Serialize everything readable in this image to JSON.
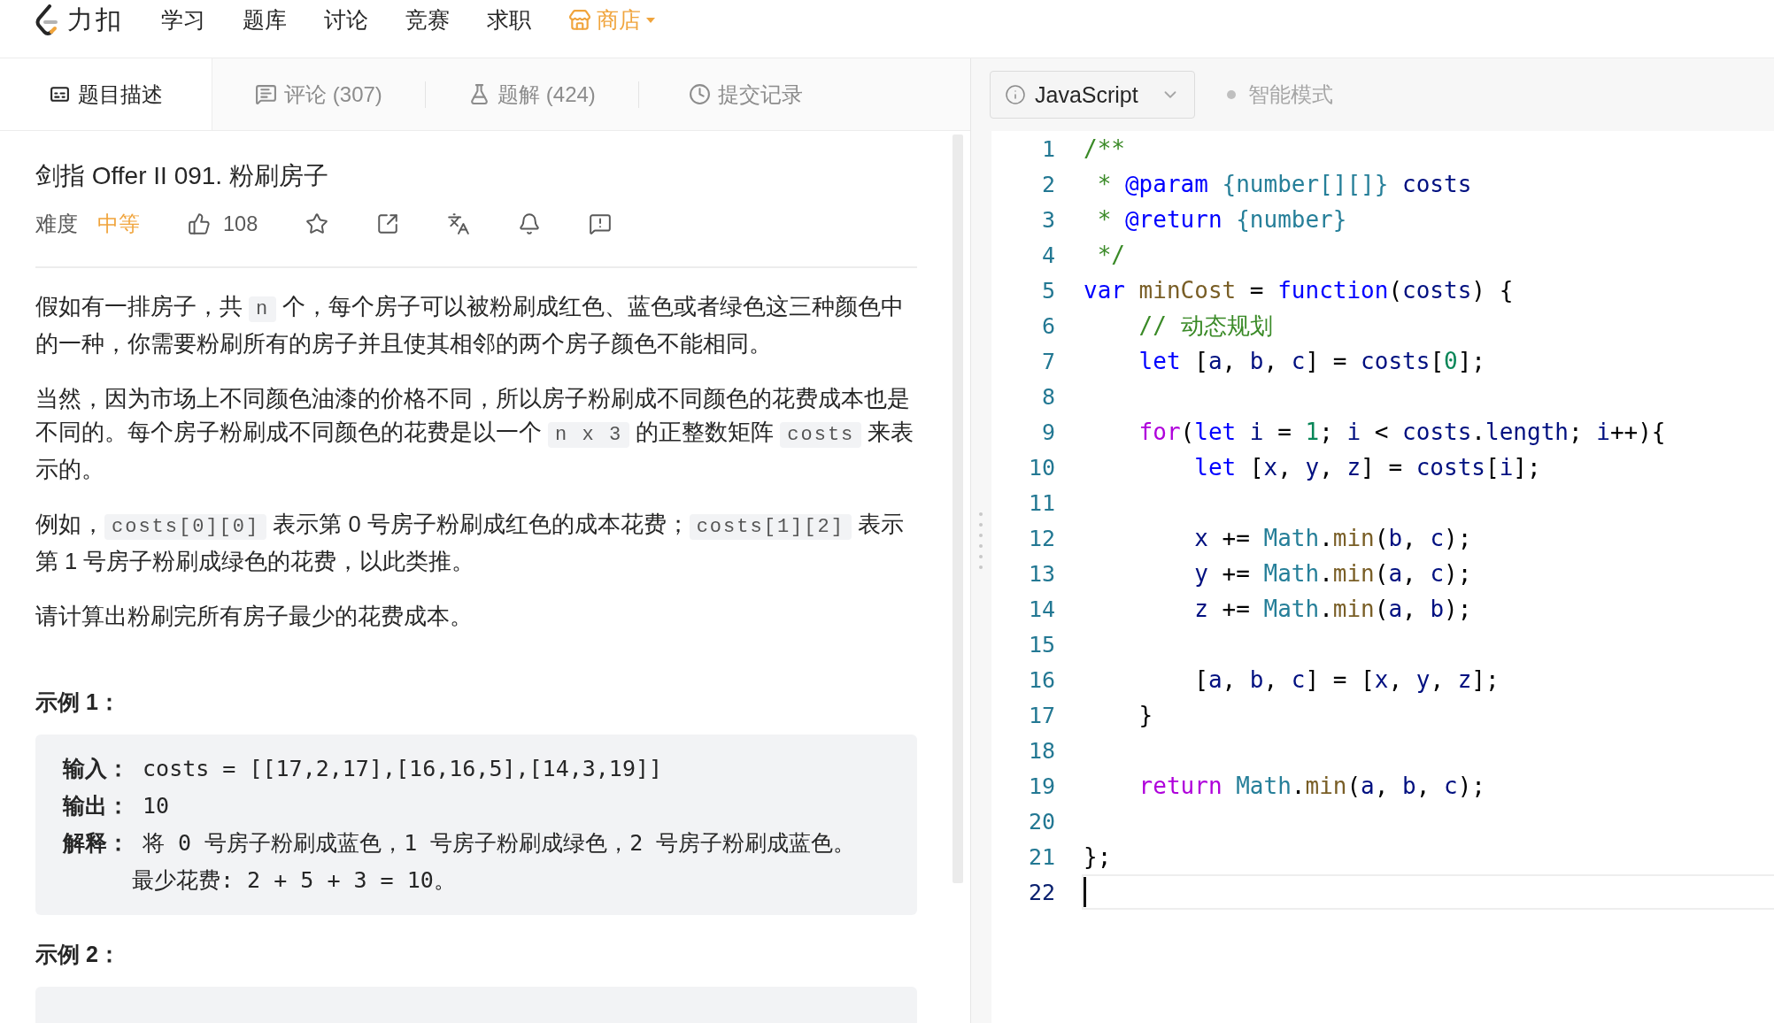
{
  "nav": {
    "brand": "力扣",
    "items": [
      {
        "label": "学习",
        "kind": "link"
      },
      {
        "label": "题库",
        "kind": "link"
      },
      {
        "label": "讨论",
        "kind": "link"
      },
      {
        "label": "竞赛",
        "kind": "link"
      },
      {
        "label": "求职",
        "kind": "link"
      },
      {
        "label": "商店",
        "kind": "store"
      }
    ]
  },
  "tabs": [
    {
      "label": "题目描述",
      "selected": true
    },
    {
      "label": "评论 (307)",
      "selected": false
    },
    {
      "label": "题解 (424)",
      "selected": false
    },
    {
      "label": "提交记录",
      "selected": false
    }
  ],
  "problem": {
    "title": "剑指 Offer II 091. 粉刷房子",
    "difficulty_label": "难度",
    "difficulty": "中等",
    "likes": "108",
    "paragraphs": [
      [
        {
          "text": "假如有一排房子，共 "
        },
        {
          "text": "n",
          "code": true
        },
        {
          "text": " 个，每个房子可以被粉刷成红色、蓝色或者绿色这三种颜色中的一种，你需要粉刷所有的房子并且使其相邻的两个房子颜色不能相同。"
        }
      ],
      [
        {
          "text": "当然，因为市场上不同颜色油漆的价格不同，所以房子粉刷成不同颜色的花费成本也是不同的。每个房子粉刷成不同颜色的花费是以一个 "
        },
        {
          "text": "n x 3",
          "code": true
        },
        {
          "text": " 的正整数矩阵 "
        },
        {
          "text": "costs",
          "code": true
        },
        {
          "text": " 来表示的。"
        }
      ],
      [
        {
          "text": "例如，"
        },
        {
          "text": "costs[0][0]",
          "code": true
        },
        {
          "text": " 表示第 0 号房子粉刷成红色的成本花费；"
        },
        {
          "text": "costs[1][2]",
          "code": true
        },
        {
          "text": " 表示第 1 号房子粉刷成绿色的花费，以此类推。"
        }
      ],
      [
        {
          "text": "请计算出粉刷完所有房子最少的花费成本。"
        }
      ]
    ],
    "examples": [
      {
        "title": "示例 1：",
        "lines": [
          {
            "kind": "line",
            "text": "**输入：** costs = [[17,2,17],[16,16,5],[14,3,19]]"
          },
          {
            "kind": "line",
            "text": "**输出：** 10"
          },
          {
            "kind": "line",
            "text": "**解释：** 将 0 号房子粉刷成蓝色，1 号房子粉刷成绿色，2 号房子粉刷成蓝色。"
          },
          {
            "kind": "continuation",
            "text": "最少花费: 2 + 5 + 3 = 10。"
          }
        ]
      },
      {
        "title": "示例 2："
      }
    ]
  },
  "editor": {
    "language": "JavaScript",
    "smart_mode": "智能模式",
    "lines": [
      {
        "number": "1",
        "tokens": [
          {
            "kind": "comment",
            "text": "/**"
          }
        ]
      },
      {
        "number": "2",
        "tokens": [
          {
            "kind": "comment",
            "text": " * "
          },
          {
            "kind": "keyword",
            "text": "@param"
          },
          {
            "kind": "type",
            "text": " {number[][]}"
          },
          {
            "kind": "variable",
            "text": " costs"
          }
        ]
      },
      {
        "number": "3",
        "tokens": [
          {
            "kind": "comment",
            "text": " * "
          },
          {
            "kind": "keyword",
            "text": "@return"
          },
          {
            "kind": "type",
            "text": " {number}"
          }
        ]
      },
      {
        "number": "4",
        "tokens": [
          {
            "kind": "comment",
            "text": " */"
          }
        ]
      },
      {
        "number": "5",
        "tokens": [
          {
            "kind": "keyword",
            "text": "var"
          },
          {
            "kind": "function",
            "text": " minCost"
          },
          {
            "kind": "plain",
            "text": " = "
          },
          {
            "kind": "keyword",
            "text": "function"
          },
          {
            "kind": "plain",
            "text": "("
          },
          {
            "kind": "variable",
            "text": "costs"
          },
          {
            "kind": "plain",
            "text": ") {"
          }
        ]
      },
      {
        "number": "6",
        "tokens": [
          {
            "kind": "comment",
            "text": "    // 动态规划"
          }
        ]
      },
      {
        "number": "7",
        "tokens": [
          {
            "kind": "keyword",
            "text": "    let"
          },
          {
            "kind": "plain",
            "text": " ["
          },
          {
            "kind": "variable",
            "text": "a"
          },
          {
            "kind": "plain",
            "text": ", "
          },
          {
            "kind": "variable",
            "text": "b"
          },
          {
            "kind": "plain",
            "text": ", "
          },
          {
            "kind": "variable",
            "text": "c"
          },
          {
            "kind": "plain",
            "text": "] = "
          },
          {
            "kind": "variable",
            "text": "costs"
          },
          {
            "kind": "plain",
            "text": "["
          },
          {
            "kind": "number",
            "text": "0"
          },
          {
            "kind": "plain",
            "text": "];"
          }
        ]
      },
      {
        "number": "8"
      },
      {
        "number": "9",
        "tokens": [
          {
            "kind": "control",
            "text": "    for"
          },
          {
            "kind": "plain",
            "text": "("
          },
          {
            "kind": "keyword",
            "text": "let"
          },
          {
            "kind": "variable",
            "text": " i"
          },
          {
            "kind": "plain",
            "text": " = "
          },
          {
            "kind": "number",
            "text": "1"
          },
          {
            "kind": "plain",
            "text": "; "
          },
          {
            "kind": "variable",
            "text": "i"
          },
          {
            "kind": "plain",
            "text": " < "
          },
          {
            "kind": "variable",
            "text": "costs"
          },
          {
            "kind": "plain",
            "text": "."
          },
          {
            "kind": "variable",
            "text": "length"
          },
          {
            "kind": "plain",
            "text": "; "
          },
          {
            "kind": "variable",
            "text": "i"
          },
          {
            "kind": "plain",
            "text": "++){"
          }
        ]
      },
      {
        "number": "10",
        "tokens": [
          {
            "kind": "keyword",
            "text": "        let"
          },
          {
            "kind": "plain",
            "text": " ["
          },
          {
            "kind": "variable",
            "text": "x"
          },
          {
            "kind": "plain",
            "text": ", "
          },
          {
            "kind": "variable",
            "text": "y"
          },
          {
            "kind": "plain",
            "text": ", "
          },
          {
            "kind": "variable",
            "text": "z"
          },
          {
            "kind": "plain",
            "text": "] = "
          },
          {
            "kind": "variable",
            "text": "costs"
          },
          {
            "kind": "plain",
            "text": "["
          },
          {
            "kind": "variable",
            "text": "i"
          },
          {
            "kind": "plain",
            "text": "];"
          }
        ]
      },
      {
        "number": "11"
      },
      {
        "number": "12",
        "tokens": [
          {
            "kind": "variable",
            "text": "        x"
          },
          {
            "kind": "plain",
            "text": " += "
          },
          {
            "kind": "class",
            "text": "Math"
          },
          {
            "kind": "plain",
            "text": "."
          },
          {
            "kind": "function",
            "text": "min"
          },
          {
            "kind": "plain",
            "text": "("
          },
          {
            "kind": "variable",
            "text": "b"
          },
          {
            "kind": "plain",
            "text": ", "
          },
          {
            "kind": "variable",
            "text": "c"
          },
          {
            "kind": "plain",
            "text": ");"
          }
        ]
      },
      {
        "number": "13",
        "tokens": [
          {
            "kind": "variable",
            "text": "        y"
          },
          {
            "kind": "plain",
            "text": " += "
          },
          {
            "kind": "class",
            "text": "Math"
          },
          {
            "kind": "plain",
            "text": "."
          },
          {
            "kind": "function",
            "text": "min"
          },
          {
            "kind": "plain",
            "text": "("
          },
          {
            "kind": "variable",
            "text": "a"
          },
          {
            "kind": "plain",
            "text": ", "
          },
          {
            "kind": "variable",
            "text": "c"
          },
          {
            "kind": "plain",
            "text": ");"
          }
        ]
      },
      {
        "number": "14",
        "tokens": [
          {
            "kind": "variable",
            "text": "        z"
          },
          {
            "kind": "plain",
            "text": " += "
          },
          {
            "kind": "class",
            "text": "Math"
          },
          {
            "kind": "plain",
            "text": "."
          },
          {
            "kind": "function",
            "text": "min"
          },
          {
            "kind": "plain",
            "text": "("
          },
          {
            "kind": "variable",
            "text": "a"
          },
          {
            "kind": "plain",
            "text": ", "
          },
          {
            "kind": "variable",
            "text": "b"
          },
          {
            "kind": "plain",
            "text": ");"
          }
        ]
      },
      {
        "number": "15"
      },
      {
        "number": "16",
        "tokens": [
          {
            "kind": "plain",
            "text": "        ["
          },
          {
            "kind": "variable",
            "text": "a"
          },
          {
            "kind": "plain",
            "text": ", "
          },
          {
            "kind": "variable",
            "text": "b"
          },
          {
            "kind": "plain",
            "text": ", "
          },
          {
            "kind": "variable",
            "text": "c"
          },
          {
            "kind": "plain",
            "text": "] = ["
          },
          {
            "kind": "variable",
            "text": "x"
          },
          {
            "kind": "plain",
            "text": ", "
          },
          {
            "kind": "variable",
            "text": "y"
          },
          {
            "kind": "plain",
            "text": ", "
          },
          {
            "kind": "variable",
            "text": "z"
          },
          {
            "kind": "plain",
            "text": "];"
          }
        ]
      },
      {
        "number": "17",
        "tokens": [
          {
            "kind": "plain",
            "text": "    }"
          }
        ]
      },
      {
        "number": "18"
      },
      {
        "number": "19",
        "tokens": [
          {
            "kind": "control",
            "text": "    return"
          },
          {
            "kind": "class",
            "text": " Math"
          },
          {
            "kind": "plain",
            "text": "."
          },
          {
            "kind": "function",
            "text": "min"
          },
          {
            "kind": "plain",
            "text": "("
          },
          {
            "kind": "variable",
            "text": "a"
          },
          {
            "kind": "plain",
            "text": ", "
          },
          {
            "kind": "variable",
            "text": "b"
          },
          {
            "kind": "plain",
            "text": ", "
          },
          {
            "kind": "variable",
            "text": "c"
          },
          {
            "kind": "plain",
            "text": ");"
          }
        ]
      },
      {
        "number": "20"
      },
      {
        "number": "21",
        "tokens": [
          {
            "kind": "plain",
            "text": "};"
          }
        ]
      },
      {
        "number": "22",
        "current": true
      }
    ]
  }
}
